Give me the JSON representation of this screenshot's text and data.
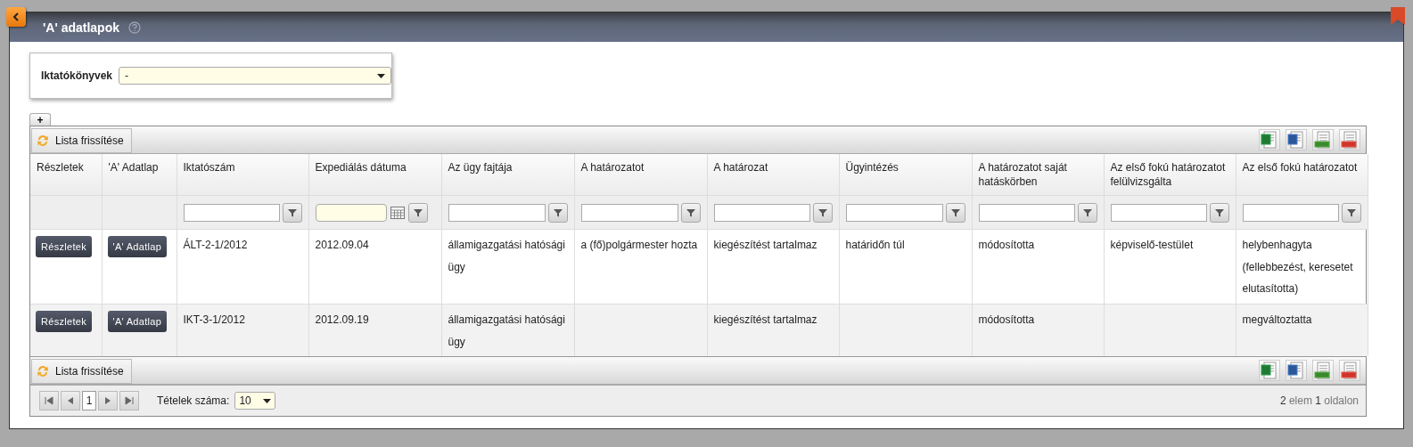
{
  "window": {
    "title": "'A' adatlapok"
  },
  "filter_panel": {
    "label": "Iktatókönyvek",
    "value": "-"
  },
  "add_tab": "+",
  "grid": {
    "top_toolbar": {
      "refresh": "Lista frissítése"
    },
    "columns": [
      {
        "title": "Részletek",
        "filter": {
          "kind": "none"
        }
      },
      {
        "title": "'A' Adatlap",
        "filter": {
          "kind": "none"
        }
      },
      {
        "title": "Iktatószám",
        "filter": {
          "kind": "text"
        }
      },
      {
        "title": "Expediálás dátuma",
        "filter": {
          "kind": "date"
        }
      },
      {
        "title": "Az ügy fajtája",
        "filter": {
          "kind": "text"
        }
      },
      {
        "title": "A határozatot",
        "filter": {
          "kind": "text"
        }
      },
      {
        "title": "A határozat",
        "filter": {
          "kind": "text"
        }
      },
      {
        "title": "Ügyintézés",
        "filter": {
          "kind": "text"
        }
      },
      {
        "title": "A határozatot saját hatáskörben",
        "filter": {
          "kind": "text"
        }
      },
      {
        "title": "Az első fokú határozatot felülvizsgálta",
        "filter": {
          "kind": "text"
        }
      },
      {
        "title": "Az első fokú határozatot",
        "filter": {
          "kind": "text"
        }
      }
    ],
    "rows": [
      {
        "cells": [
          "Részletek",
          "'A' Adatlap",
          "ÁLT-2-1/2012",
          "2012.09.04",
          "államigazgatási hatósági ügy",
          "a (fő)polgármester hozta",
          "kiegészítést tartalmaz",
          "határidőn túl",
          "módosította",
          "képviselő-testület",
          "helybenhagyta (fellebbezést, keresetet elutasította)"
        ]
      },
      {
        "cells": [
          "Részletek",
          "'A' Adatlap",
          "IKT-3-1/2012",
          "2012.09.19",
          "államigazgatási hatósági ügy",
          "",
          "kiegészítést tartalmaz",
          "",
          "módosította",
          "",
          "megváltoztatta"
        ]
      }
    ],
    "bottom_toolbar": {
      "refresh": "Lista frissítése"
    },
    "pager": {
      "page": "1",
      "page_size_label": "Tételek száma:",
      "page_size": "10",
      "summary": "**2** elem **1** oldalon"
    }
  }
}
